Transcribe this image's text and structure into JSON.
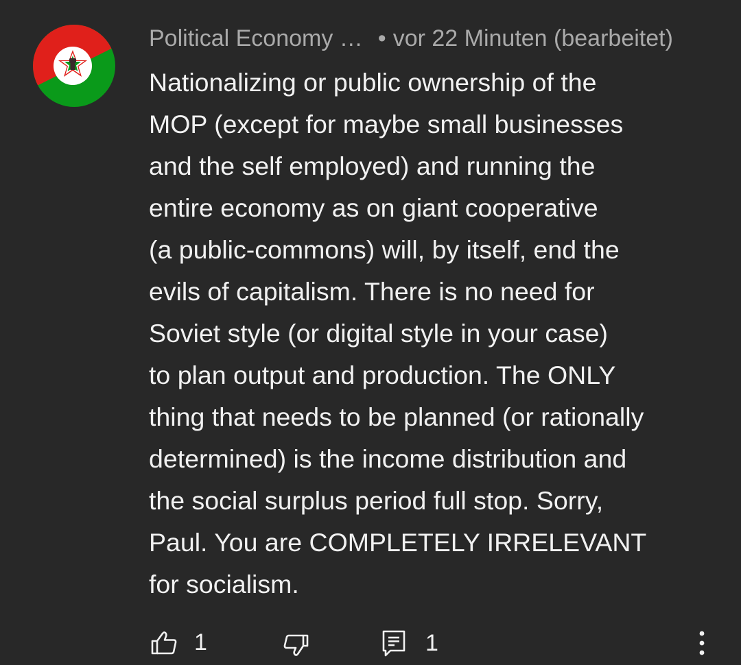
{
  "comment": {
    "author": "Political Economy …",
    "separator": "•",
    "time": "vor 22 Minuten (bearbeitet)",
    "text": "Nationalizing or public ownership of the\nMOP (except for maybe small businesses\nand the self employed) and running the\nentire economy as on giant cooperative\n(a public-commons) will, by itself, end the\nevils of capitalism. There is no need for\nSoviet style (or digital style in your case)\nto plan output and production. The ONLY\nthing that needs to be planned (or rationally\ndetermined) is the income distribution and\nthe social surplus period full stop. Sorry,\nPaul. You are COMPLETELY IRRELEVANT\nfor socialism.",
    "like_count": "1",
    "reply_count": "1"
  },
  "colors": {
    "background": "#282828",
    "text": "#f1f1f1",
    "meta": "#aaaaaa",
    "avatar_red": "#e0201b",
    "avatar_green": "#0a9a1a"
  },
  "icons": {
    "avatar": "red-green-star-fist-logo",
    "like": "thumbs-up-icon",
    "dislike": "thumbs-down-icon",
    "reply": "comment-reply-icon",
    "more": "vertical-dots-icon"
  }
}
